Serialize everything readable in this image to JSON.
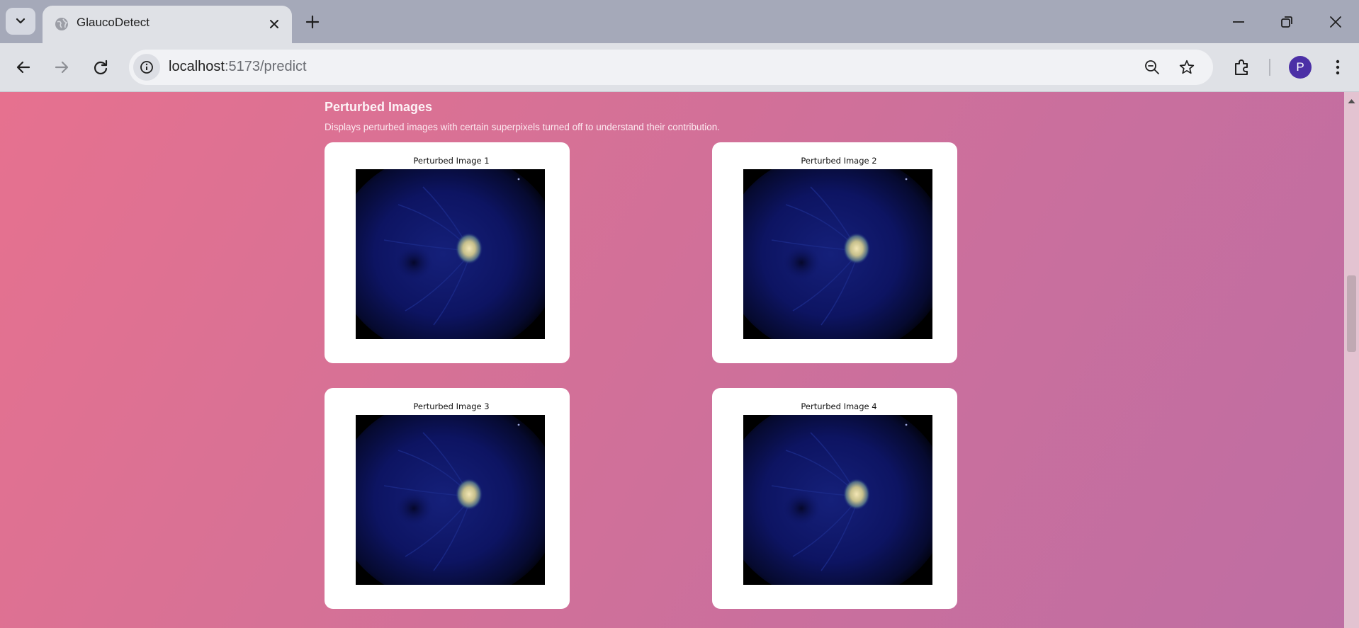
{
  "browser": {
    "tab_title": "GlaucoDetect",
    "url_host": "localhost",
    "url_path": ":5173/predict",
    "profile_initial": "P",
    "icons": [
      "tab-search-icon",
      "globe-icon",
      "close-icon",
      "plus-icon",
      "minimize-icon",
      "restore-icon",
      "window-close-icon",
      "back-icon",
      "forward-icon",
      "reload-icon",
      "site-info-icon",
      "zoom-out-icon",
      "star-icon",
      "extensions-icon",
      "more-vert-icon"
    ]
  },
  "page": {
    "section_title": "Perturbed Images",
    "section_description": "Displays perturbed images with certain superpixels turned off to understand their contribution.",
    "images": [
      {
        "title": "Perturbed Image 1"
      },
      {
        "title": "Perturbed Image 2"
      },
      {
        "title": "Perturbed Image 3"
      },
      {
        "title": "Perturbed Image 4"
      }
    ]
  },
  "colors": {
    "tab_strip": "#a5a9b9",
    "toolbar": "#dfe1e6",
    "avatar": "#4b2fa6",
    "page_gradient_start": "#e6718f",
    "page_gradient_end": "#be6ea3"
  }
}
